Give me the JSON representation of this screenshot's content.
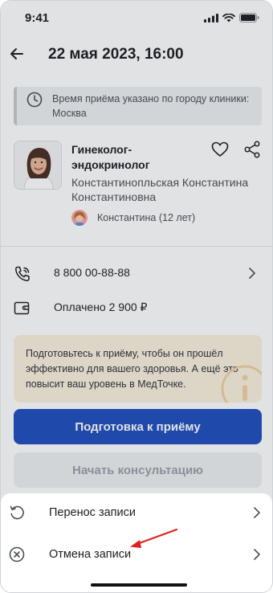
{
  "status_bar": {
    "time": "9:41"
  },
  "header": {
    "title": "22 мая 2023, 16:00"
  },
  "notice": {
    "text": "Время приёма указано по городу клиники: Москва"
  },
  "doctor": {
    "specialty": "Гинеколог-эндокринолог",
    "name": "Константинопльская Константина Константиновна",
    "patient": "Константина (12 лет)"
  },
  "contact": {
    "phone": "8 800 00-88-88"
  },
  "payment": {
    "status": "Оплачено 2 900 ₽"
  },
  "info_card": {
    "text": "Подготовьтесь к приёму, чтобы он прошёл эффективно для вашего здоровья. А ещё это повысит ваш уровень в МедТочке."
  },
  "buttons": {
    "prepare": "Подготовка к приёму",
    "start": "Начать консультацию"
  },
  "sheet": {
    "items": [
      {
        "label": "Перенос записи",
        "icon": "reschedule-icon"
      },
      {
        "label": "Отмена записи",
        "icon": "cancel-icon"
      }
    ]
  },
  "colors": {
    "primary": "#1e4fbf",
    "info_bg": "#fbf1df",
    "annotation_arrow": "#e02020"
  }
}
